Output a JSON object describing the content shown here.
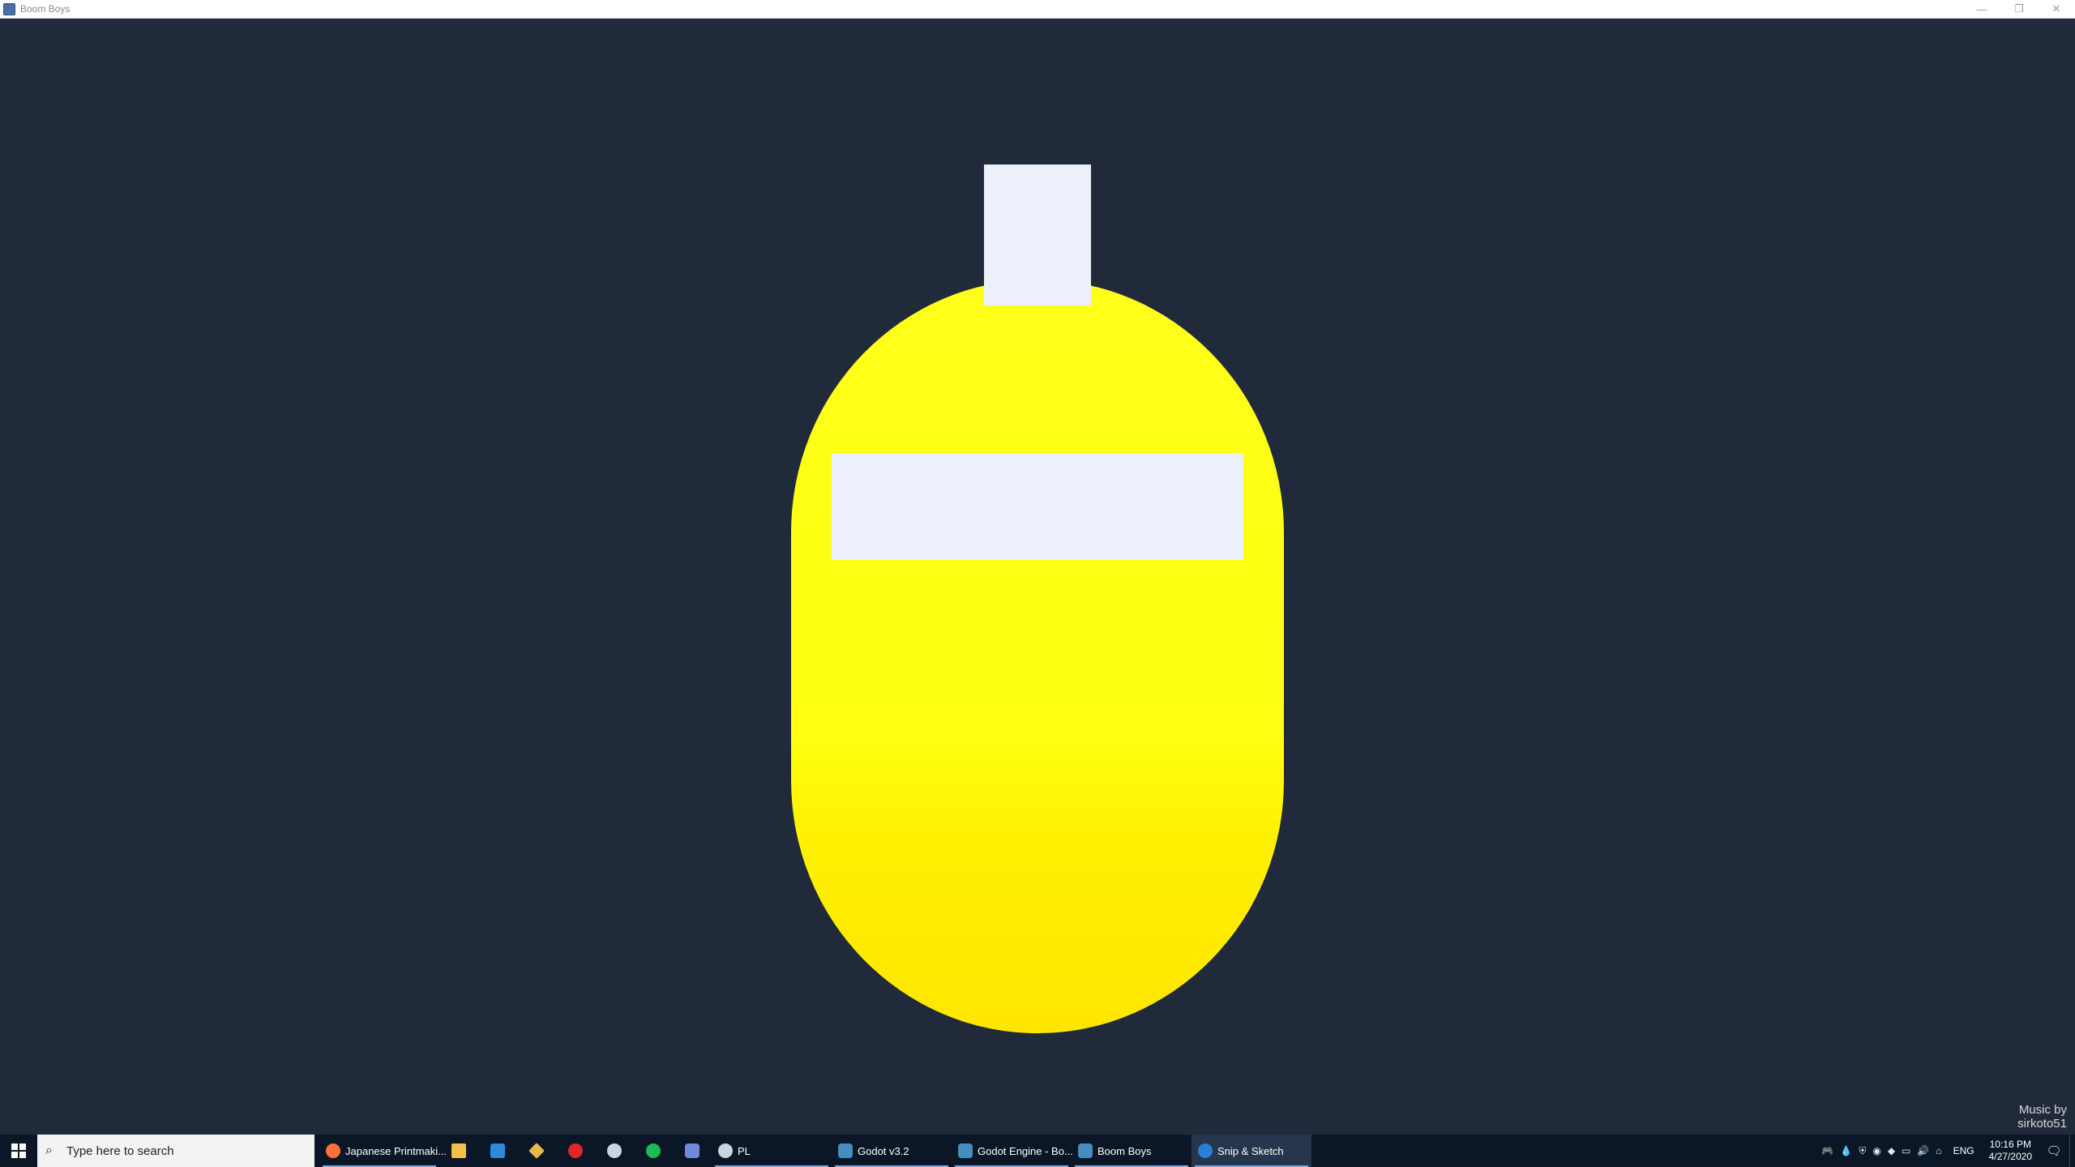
{
  "window": {
    "title": "Boom Boys",
    "controls": {
      "minimize": "—",
      "restore": "❐",
      "close": "✕"
    }
  },
  "game": {
    "music_credit_line1": "Music by",
    "music_credit_line2": "sirkoto51",
    "colors": {
      "background": "#212a3b",
      "body": "#ffff1a",
      "body_shade": "#ffe800",
      "visor": "#ecf0fa"
    }
  },
  "taskbar": {
    "search_placeholder": "Type here to search",
    "items": [
      {
        "label": "Japanese Printmaki...",
        "icon": "firefox-icon",
        "color": "#ff7139"
      },
      {
        "label": "",
        "icon": "file-explorer-icon",
        "color": "#f0c24a"
      },
      {
        "label": "",
        "icon": "vscode-icon",
        "color": "#2b8bd8"
      },
      {
        "label": "",
        "icon": "git-icon",
        "color": "#e7b84a"
      },
      {
        "label": "",
        "icon": "app-red-icon",
        "color": "#e0282c"
      },
      {
        "label": "",
        "icon": "steam-icon",
        "color": "#1b2838"
      },
      {
        "label": "",
        "icon": "spotify-icon",
        "color": "#1db954"
      },
      {
        "label": "",
        "icon": "discord-icon",
        "color": "#7289da"
      },
      {
        "label": "PL",
        "icon": "steam-icon",
        "color": "#1b2838"
      },
      {
        "label": "Godot v3.2",
        "icon": "godot-icon",
        "color": "#478cbf"
      },
      {
        "label": "Godot Engine - Bo...",
        "icon": "godot-icon",
        "color": "#478cbf"
      },
      {
        "label": "Boom Boys",
        "icon": "godot-icon",
        "color": "#478cbf"
      },
      {
        "label": "Snip & Sketch",
        "icon": "snip-sketch-icon",
        "color": "#2b7fd8"
      }
    ],
    "tray": {
      "language": "ENG",
      "time": "10:16 PM",
      "date": "4/27/2020"
    }
  }
}
